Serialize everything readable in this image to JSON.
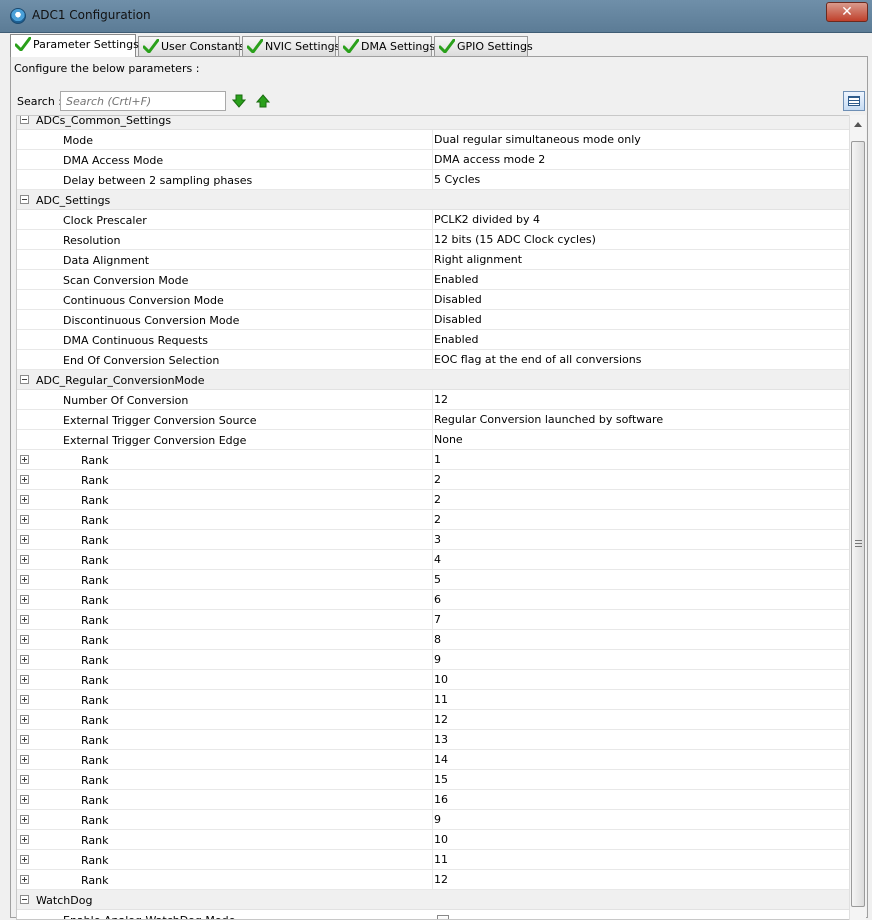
{
  "window": {
    "title": "ADC1 Configuration",
    "close_label": "✕"
  },
  "tabs": [
    {
      "label": "Parameter Settings",
      "active": true
    },
    {
      "label": "User Constants"
    },
    {
      "label": "NVIC Settings"
    },
    {
      "label": "DMA Settings"
    },
    {
      "label": "GPIO Settings"
    }
  ],
  "configure_label": "Configure the below parameters :",
  "search": {
    "label": "Search :",
    "placeholder": "Search (Crtl+F)"
  },
  "colors": {
    "check_green": "#2aa01b",
    "arrow_green": "#27a51a"
  },
  "groups": [
    {
      "name": "ADCs_Common_Settings",
      "rows": [
        {
          "name": "Mode",
          "value": "Dual regular simultaneous mode only"
        },
        {
          "name": "DMA Access Mode",
          "value": "DMA access mode 2"
        },
        {
          "name": "Delay between 2 sampling phases",
          "value": "5 Cycles"
        }
      ]
    },
    {
      "name": "ADC_Settings",
      "rows": [
        {
          "name": "Clock Prescaler",
          "value": "PCLK2 divided by 4"
        },
        {
          "name": "Resolution",
          "value": "12 bits (15 ADC Clock cycles)"
        },
        {
          "name": "Data Alignment",
          "value": "Right alignment"
        },
        {
          "name": "Scan Conversion Mode",
          "value": "Enabled"
        },
        {
          "name": "Continuous Conversion Mode",
          "value": "Disabled"
        },
        {
          "name": "Discontinuous Conversion Mode",
          "value": "Disabled"
        },
        {
          "name": "DMA Continuous Requests",
          "value": "Enabled"
        },
        {
          "name": "End Of Conversion Selection",
          "value": "EOC flag at the end of all conversions"
        }
      ]
    },
    {
      "name": "ADC_Regular_ConversionMode",
      "rows": [
        {
          "name": "Number Of Conversion",
          "value": "12"
        },
        {
          "name": "External Trigger Conversion Source",
          "value": "Regular Conversion launched by software"
        },
        {
          "name": "External Trigger Conversion Edge",
          "value": "None"
        },
        {
          "name": "Rank",
          "value": "1",
          "rank": true
        },
        {
          "name": "Rank",
          "value": "2",
          "rank": true
        },
        {
          "name": "Rank",
          "value": "2",
          "rank": true
        },
        {
          "name": "Rank",
          "value": "2",
          "rank": true
        },
        {
          "name": "Rank",
          "value": "3",
          "rank": true
        },
        {
          "name": "Rank",
          "value": "4",
          "rank": true
        },
        {
          "name": "Rank",
          "value": "5",
          "rank": true
        },
        {
          "name": "Rank",
          "value": "6",
          "rank": true
        },
        {
          "name": "Rank",
          "value": "7",
          "rank": true
        },
        {
          "name": "Rank",
          "value": "8",
          "rank": true
        },
        {
          "name": "Rank",
          "value": "9",
          "rank": true
        },
        {
          "name": "Rank",
          "value": "10",
          "rank": true
        },
        {
          "name": "Rank",
          "value": "11",
          "rank": true
        },
        {
          "name": "Rank",
          "value": "12",
          "rank": true
        },
        {
          "name": "Rank",
          "value": "13",
          "rank": true
        },
        {
          "name": "Rank",
          "value": "14",
          "rank": true
        },
        {
          "name": "Rank",
          "value": "15",
          "rank": true
        },
        {
          "name": "Rank",
          "value": "16",
          "rank": true
        },
        {
          "name": "Rank",
          "value": "9",
          "rank": true
        },
        {
          "name": "Rank",
          "value": "10",
          "rank": true
        },
        {
          "name": "Rank",
          "value": "11",
          "rank": true
        },
        {
          "name": "Rank",
          "value": "12",
          "rank": true
        }
      ]
    },
    {
      "name": "WatchDog",
      "rows": [
        {
          "name": "Enable Analog WatchDog Mode",
          "checkbox": true
        }
      ]
    }
  ]
}
